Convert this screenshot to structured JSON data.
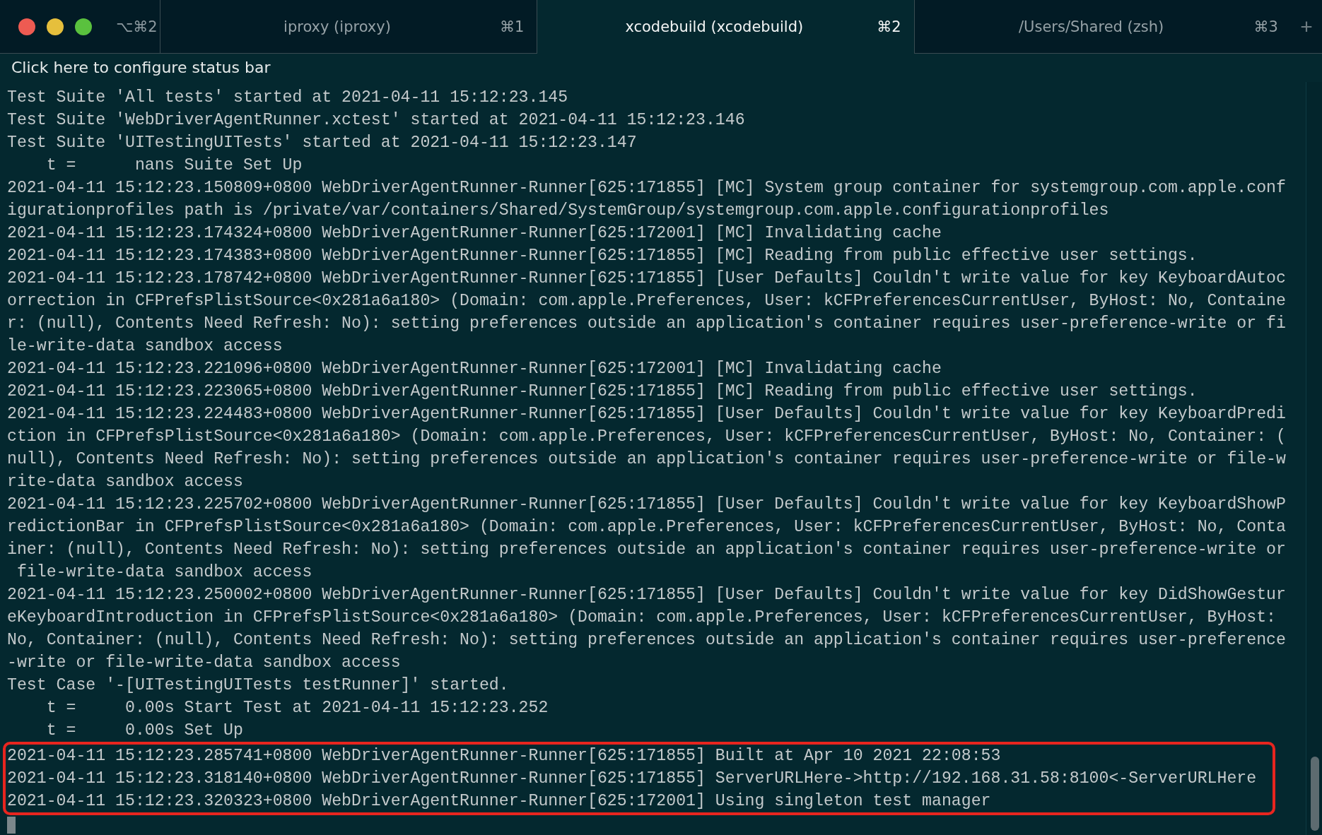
{
  "window": {
    "shortcut": "⌥⌘2"
  },
  "tabs": [
    {
      "title": "iproxy (iproxy)",
      "shortcut": "⌘1",
      "selected": false
    },
    {
      "title": "xcodebuild (xcodebuild)",
      "shortcut": "⌘2",
      "selected": true
    },
    {
      "title": "/Users/Shared (zsh)",
      "shortcut": "⌘3",
      "selected": false
    }
  ],
  "new_tab": "+",
  "status_bar": "Click here to configure status bar",
  "lines": [
    "Test Suite 'All tests' started at 2021-04-11 15:12:23.145",
    "Test Suite 'WebDriverAgentRunner.xctest' started at 2021-04-11 15:12:23.146",
    "Test Suite 'UITestingUITests' started at 2021-04-11 15:12:23.147",
    "    t =      nans Suite Set Up",
    "2021-04-11 15:12:23.150809+0800 WebDriverAgentRunner-Runner[625:171855] [MC] System group container for systemgroup.com.apple.conf",
    "igurationprofiles path is /private/var/containers/Shared/SystemGroup/systemgroup.com.apple.configurationprofiles",
    "2021-04-11 15:12:23.174324+0800 WebDriverAgentRunner-Runner[625:172001] [MC] Invalidating cache",
    "2021-04-11 15:12:23.174383+0800 WebDriverAgentRunner-Runner[625:171855] [MC] Reading from public effective user settings.",
    "2021-04-11 15:12:23.178742+0800 WebDriverAgentRunner-Runner[625:171855] [User Defaults] Couldn't write value for key KeyboardAutoc",
    "orrection in CFPrefsPlistSource<0x281a6a180> (Domain: com.apple.Preferences, User: kCFPreferencesCurrentUser, ByHost: No, Containe",
    "r: (null), Contents Need Refresh: No): setting preferences outside an application's container requires user-preference-write or fi",
    "le-write-data sandbox access",
    "2021-04-11 15:12:23.221096+0800 WebDriverAgentRunner-Runner[625:172001] [MC] Invalidating cache",
    "2021-04-11 15:12:23.223065+0800 WebDriverAgentRunner-Runner[625:171855] [MC] Reading from public effective user settings.",
    "2021-04-11 15:12:23.224483+0800 WebDriverAgentRunner-Runner[625:171855] [User Defaults] Couldn't write value for key KeyboardPredi",
    "ction in CFPrefsPlistSource<0x281a6a180> (Domain: com.apple.Preferences, User: kCFPreferencesCurrentUser, ByHost: No, Container: (",
    "null), Contents Need Refresh: No): setting preferences outside an application's container requires user-preference-write or file-w",
    "rite-data sandbox access",
    "2021-04-11 15:12:23.225702+0800 WebDriverAgentRunner-Runner[625:171855] [User Defaults] Couldn't write value for key KeyboardShowP",
    "redictionBar in CFPrefsPlistSource<0x281a6a180> (Domain: com.apple.Preferences, User: kCFPreferencesCurrentUser, ByHost: No, Conta",
    "iner: (null), Contents Need Refresh: No): setting preferences outside an application's container requires user-preference-write or",
    " file-write-data sandbox access",
    "2021-04-11 15:12:23.250002+0800 WebDriverAgentRunner-Runner[625:171855] [User Defaults] Couldn't write value for key DidShowGestur",
    "eKeyboardIntroduction in CFPrefsPlistSource<0x281a6a180> (Domain: com.apple.Preferences, User: kCFPreferencesCurrentUser, ByHost:",
    "No, Container: (null), Contents Need Refresh: No): setting preferences outside an application's container requires user-preference",
    "-write or file-write-data sandbox access",
    "Test Case '-[UITestingUITests testRunner]' started.",
    "    t =     0.00s Start Test at 2021-04-11 15:12:23.252",
    "    t =     0.00s Set Up"
  ],
  "highlighted_lines": [
    "2021-04-11 15:12:23.285741+0800 WebDriverAgentRunner-Runner[625:171855] Built at Apr 10 2021 22:08:53",
    "2021-04-11 15:12:23.318140+0800 WebDriverAgentRunner-Runner[625:171855] ServerURLHere->http://192.168.31.58:8100<-ServerURLHere",
    "2021-04-11 15:12:23.320323+0800 WebDriverAgentRunner-Runner[625:172001] Using singleton test manager"
  ]
}
